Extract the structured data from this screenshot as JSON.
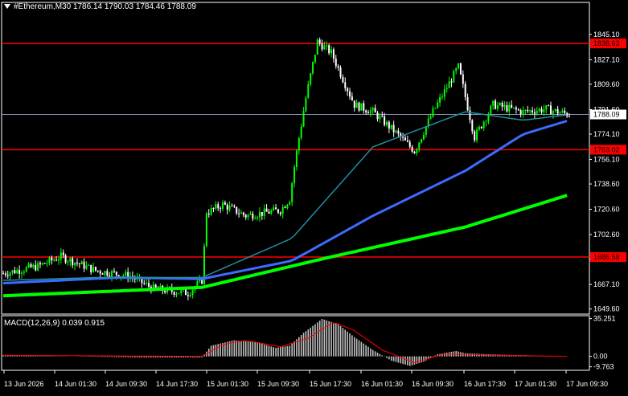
{
  "header": {
    "symbol": "#Ethereum,M30",
    "open": "1786.14",
    "high": "1790.03",
    "low": "1784.46",
    "close": "1788.09"
  },
  "macd_header": {
    "label": "MACD(12,26,9)",
    "main": "0.039",
    "signal": "0.915"
  },
  "colors": {
    "background": "#000000",
    "grid": "#ffffff",
    "bull_candle": "#00ff00",
    "bear_candle": "#ffffff",
    "level_line": "#ff0000",
    "ma_fast": "#1f8fa0",
    "ma_mid": "#3d6bff",
    "ma_slow": "#00ff00",
    "macd_hist": "#c0c0c0",
    "macd_signal": "#ff0000",
    "price_line": "#8090b0"
  },
  "chart_data": {
    "type": "candlestick",
    "y_ticks": [
      "1845.10",
      "1827.10",
      "1809.60",
      "1791.60",
      "1774.10",
      "1756.10",
      "1738.60",
      "1720.60",
      "1702.60",
      "1685.10",
      "1667.10",
      "1649.60"
    ],
    "y_tick_values": [
      1845.1,
      1827.1,
      1809.6,
      1791.6,
      1774.1,
      1756.1,
      1738.6,
      1720.6,
      1702.6,
      1685.1,
      1667.1,
      1649.6
    ],
    "ylim": [
      1646,
      1861
    ],
    "x_ticks": [
      "13 Jun 2026",
      "14 Jun 01:30",
      "14 Jun 09:30",
      "14 Jun 17:30",
      "15 Jun 01:30",
      "15 Jun 09:30",
      "15 Jun 17:30",
      "16 Jun 01:30",
      "16 Jun 09:30",
      "16 Jun 17:30",
      "17 Jun 01:30",
      "17 Jun 09:30"
    ],
    "levels": [
      {
        "label": "1838.63",
        "value": 1838.63
      },
      {
        "label": "1763.02",
        "value": 1763.02
      },
      {
        "label": "1686.58",
        "value": 1686.58
      }
    ],
    "current_price": {
      "label": "1788.09",
      "value": 1788.09
    },
    "anchors": [
      {
        "i": 0,
        "p": 1675
      },
      {
        "i": 15,
        "p": 1680
      },
      {
        "i": 25,
        "p": 1687
      },
      {
        "i": 40,
        "p": 1677
      },
      {
        "i": 55,
        "p": 1673
      },
      {
        "i": 65,
        "p": 1664
      },
      {
        "i": 80,
        "p": 1661
      },
      {
        "i": 86,
        "p": 1670
      },
      {
        "i": 88,
        "p": 1718
      },
      {
        "i": 95,
        "p": 1724
      },
      {
        "i": 105,
        "p": 1716
      },
      {
        "i": 120,
        "p": 1720
      },
      {
        "i": 124,
        "p": 1728
      },
      {
        "i": 127,
        "p": 1762
      },
      {
        "i": 131,
        "p": 1800
      },
      {
        "i": 136,
        "p": 1840
      },
      {
        "i": 142,
        "p": 1832
      },
      {
        "i": 152,
        "p": 1795
      },
      {
        "i": 160,
        "p": 1790
      },
      {
        "i": 170,
        "p": 1775
      },
      {
        "i": 178,
        "p": 1762
      },
      {
        "i": 186,
        "p": 1790
      },
      {
        "i": 197,
        "p": 1822
      },
      {
        "i": 204,
        "p": 1772
      },
      {
        "i": 212,
        "p": 1795
      },
      {
        "i": 225,
        "p": 1790
      },
      {
        "i": 235,
        "p": 1792
      },
      {
        "i": 245,
        "p": 1788
      }
    ],
    "candle_count": 246,
    "ma_fast": {
      "start": 1670,
      "points": [
        [
          0,
          1670
        ],
        [
          40,
          1672
        ],
        [
          86,
          1672
        ],
        [
          125,
          1700
        ],
        [
          160,
          1765
        ],
        [
          200,
          1790
        ],
        [
          225,
          1784
        ],
        [
          245,
          1788
        ]
      ]
    },
    "ma_mid": {
      "points": [
        [
          0,
          1668
        ],
        [
          50,
          1672
        ],
        [
          86,
          1671
        ],
        [
          125,
          1684
        ],
        [
          160,
          1716
        ],
        [
          200,
          1748
        ],
        [
          225,
          1774
        ],
        [
          245,
          1784
        ]
      ]
    },
    "ma_slow": {
      "points": [
        [
          0,
          1659
        ],
        [
          86,
          1665
        ],
        [
          140,
          1686
        ],
        [
          200,
          1708
        ],
        [
          245,
          1731
        ]
      ]
    },
    "macd": {
      "y_ticks": [
        "35.251",
        "0.00",
        "-9.763"
      ],
      "y_tick_values": [
        35.251,
        0.0,
        -9.763
      ],
      "ylim": [
        -13,
        38
      ],
      "hist_anchors": [
        [
          0,
          1
        ],
        [
          30,
          0
        ],
        [
          60,
          -1
        ],
        [
          86,
          -1
        ],
        [
          90,
          10
        ],
        [
          100,
          15
        ],
        [
          110,
          13
        ],
        [
          118,
          8
        ],
        [
          124,
          10
        ],
        [
          130,
          22
        ],
        [
          138,
          35
        ],
        [
          145,
          30
        ],
        [
          152,
          18
        ],
        [
          160,
          6
        ],
        [
          168,
          -4
        ],
        [
          176,
          -9
        ],
        [
          182,
          -5
        ],
        [
          188,
          2
        ],
        [
          196,
          5
        ],
        [
          200,
          3
        ],
        [
          210,
          2
        ],
        [
          225,
          1
        ],
        [
          245,
          0
        ]
      ],
      "signal_anchors": [
        [
          0,
          1
        ],
        [
          86,
          0
        ],
        [
          95,
          11
        ],
        [
          105,
          15
        ],
        [
          120,
          9
        ],
        [
          132,
          17
        ],
        [
          143,
          32
        ],
        [
          152,
          24
        ],
        [
          164,
          6
        ],
        [
          178,
          -6
        ],
        [
          190,
          2
        ],
        [
          200,
          2
        ],
        [
          215,
          1
        ],
        [
          245,
          0
        ]
      ]
    }
  }
}
